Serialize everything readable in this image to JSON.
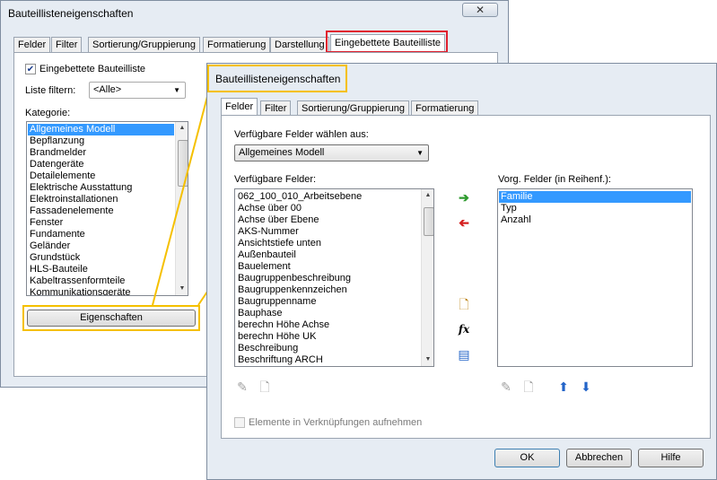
{
  "back_dialog": {
    "title": "Bauteillisteneigenschaften",
    "close_glyph": "✕",
    "tabs": [
      "Felder",
      "Filter",
      "Sortierung/Gruppierung",
      "Formatierung",
      "Darstellung",
      "Eingebettete Bauteilliste"
    ],
    "embedded_checkbox_label": "Eingebettete Bauteilliste",
    "embedded_checked": true,
    "filter_label": "Liste filtern:",
    "filter_value": "<Alle>",
    "category_label": "Kategorie:",
    "categories": [
      "Allgemeines Modell",
      "Bepflanzung",
      "Brandmelder",
      "Datengeräte",
      "Detailelemente",
      "Elektrische Ausstattung",
      "Elektroinstallationen",
      "Fassadenelemente",
      "Fenster",
      "Fundamente",
      "Geländer",
      "Grundstück",
      "HLS-Bauteile",
      "Kabeltrassenformteile",
      "Kommunikationsgeräte"
    ],
    "selected_category": "Allgemeines Modell",
    "properties_button": "Eigenschaften"
  },
  "front_dialog": {
    "title": "Bauteillisteneigenschaften",
    "tabs": [
      "Felder",
      "Filter",
      "Sortierung/Gruppierung",
      "Formatierung"
    ],
    "select_from_label": "Verfügbare Felder wählen aus:",
    "select_from_value": "Allgemeines Modell",
    "available_label": "Verfügbare Felder:",
    "available_fields": [
      "062_100_010_Arbeitsebene",
      "Achse über 00",
      "Achse über Ebene",
      "AKS-Nummer",
      "Ansichtstiefe unten",
      "Außenbauteil",
      "Bauelement",
      "Baugruppenbeschreibung",
      "Baugruppenkennzeichen",
      "Baugruppenname",
      "Bauphase",
      "berechn Höhe Achse",
      "berechn Höhe UK",
      "Beschreibung",
      "Beschriftung ARCH"
    ],
    "scheduled_label": "Vorg. Felder (in Reihenf.):",
    "scheduled_fields": [
      "Familie",
      "Typ",
      "Anzahl"
    ],
    "selected_scheduled": "Familie",
    "include_links_label": "Elemente in Verknüpfungen aufnehmen",
    "ok_button": "OK",
    "cancel_button": "Abbrechen",
    "help_button": "Hilfe",
    "fx_glyph": "fx"
  },
  "colors": {
    "highlight_red": "#e0202e",
    "highlight_yellow": "#f5c000",
    "selection_blue": "#3399ff",
    "add_arrow_green": "#2e9b2e",
    "remove_arrow_red": "#d42020",
    "move_blue": "#2364c8"
  }
}
